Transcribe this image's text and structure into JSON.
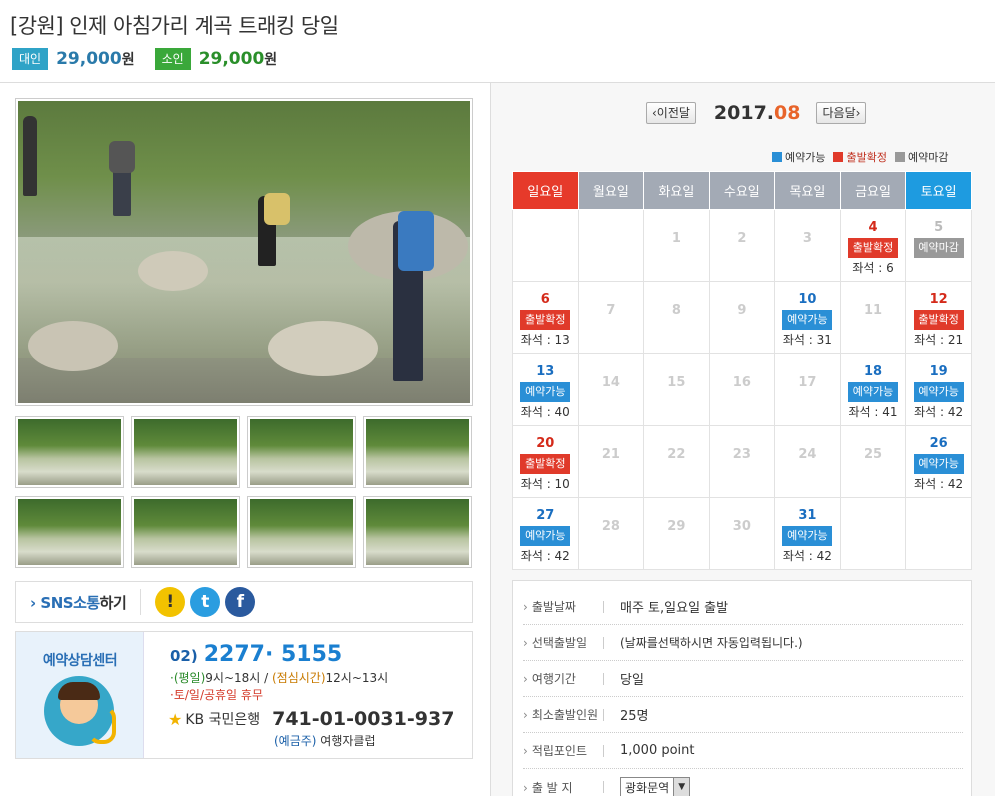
{
  "title": "[강원] 인제 아침가리 계곡 트래킹 당일",
  "prices": {
    "adult_label": "대인",
    "adult_price": "29,000",
    "adult_unit": "원",
    "child_label": "소인",
    "child_price": "29,000",
    "child_unit": "원"
  },
  "sns": {
    "label_a": "SNS소통",
    "label_b": "하기",
    "kakao": "!",
    "twitter": "t",
    "facebook": "f"
  },
  "consult": {
    "title": "예약상담센터",
    "area_code": "02)",
    "phone": "2277· 5155",
    "hours_a": "·(평일)",
    "hours_a_time": "9시~18시 / ",
    "hours_b": "(점심시간)",
    "hours_b_time": "12시~13시",
    "holiday": "·토/일/공휴일 휴무",
    "bank_mark": "★",
    "bank_name": "KB 국민은행",
    "account": "741-01-0031-937",
    "holder_label": "(예금주)",
    "holder_name": " 여행자클럽"
  },
  "calendar": {
    "prev": "‹이전달",
    "next": "다음달›",
    "year": "2017.",
    "month": "08",
    "legend": {
      "open": "예약가능",
      "confirmed": "출발확정",
      "closed": "예약마감"
    },
    "legend_colors": {
      "open": "#2a8fd6",
      "confirmed": "#e03a2a",
      "closed": "#999999"
    },
    "weekdays": [
      "일요일",
      "월요일",
      "화요일",
      "수요일",
      "목요일",
      "금요일",
      "토요일"
    ],
    "weeks": [
      [
        {
          "d": ""
        },
        {
          "d": ""
        },
        {
          "d": "1"
        },
        {
          "d": "2"
        },
        {
          "d": "3"
        },
        {
          "d": "4",
          "status": "출발확정",
          "seats": "좌석 : 6"
        },
        {
          "d": "5",
          "status": "예약마감"
        }
      ],
      [
        {
          "d": "6",
          "status": "출발확정",
          "seats": "좌석 : 13"
        },
        {
          "d": "7"
        },
        {
          "d": "8"
        },
        {
          "d": "9"
        },
        {
          "d": "10",
          "status": "예약가능",
          "seats": "좌석 : 31"
        },
        {
          "d": "11"
        },
        {
          "d": "12",
          "status": "출발확정",
          "seats": "좌석 : 21"
        }
      ],
      [
        {
          "d": "13",
          "status": "예약가능",
          "seats": "좌석 : 40"
        },
        {
          "d": "14"
        },
        {
          "d": "15"
        },
        {
          "d": "16"
        },
        {
          "d": "17"
        },
        {
          "d": "18",
          "status": "예약가능",
          "seats": "좌석 : 41"
        },
        {
          "d": "19",
          "status": "예약가능",
          "seats": "좌석 : 42"
        }
      ],
      [
        {
          "d": "20",
          "status": "출발확정",
          "seats": "좌석 : 10"
        },
        {
          "d": "21"
        },
        {
          "d": "22"
        },
        {
          "d": "23"
        },
        {
          "d": "24"
        },
        {
          "d": "25"
        },
        {
          "d": "26",
          "status": "예약가능",
          "seats": "좌석 : 42"
        }
      ],
      [
        {
          "d": "27",
          "status": "예약가능",
          "seats": "좌석 : 42"
        },
        {
          "d": "28"
        },
        {
          "d": "29"
        },
        {
          "d": "30"
        },
        {
          "d": "31",
          "status": "예약가능",
          "seats": "좌석 : 42"
        },
        {
          "d": ""
        },
        {
          "d": ""
        }
      ]
    ]
  },
  "info": {
    "depart_date_label": "출발날짜",
    "depart_date_value": "매주 토,일요일 출발",
    "select_date_label": "선택출발일",
    "select_date_value": "(날짜를선택하시면 자동입력됩니다.)",
    "duration_label": "여행기간",
    "duration_value": "당일",
    "min_people_label": "최소출발인원",
    "min_people_value": "25명",
    "points_label": "적립포인트",
    "points_value": "1,000 point",
    "departure_point_label": "출 발 지",
    "departure_point_value": "광화문역"
  }
}
